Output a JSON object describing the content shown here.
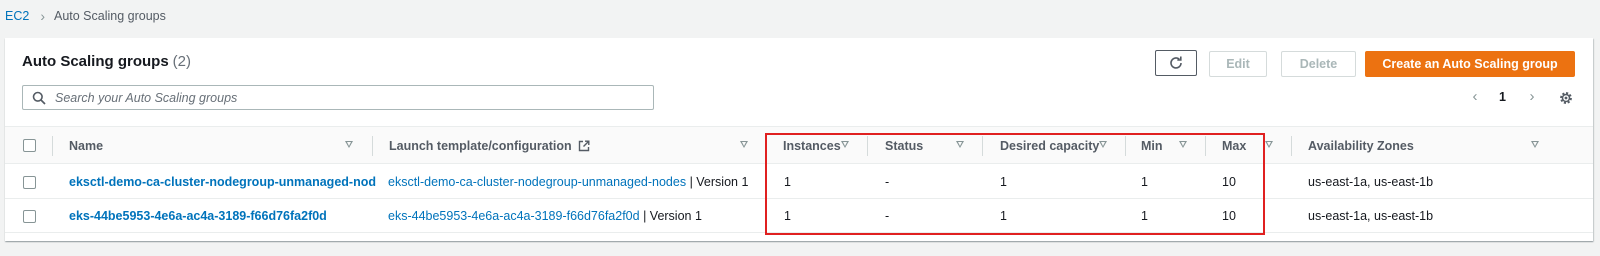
{
  "breadcrumb": {
    "root": "EC2",
    "current": "Auto Scaling groups"
  },
  "header": {
    "title": "Auto Scaling groups",
    "count": "(2)"
  },
  "toolbar": {
    "edit": "Edit",
    "delete": "Delete",
    "create": "Create an Auto Scaling group",
    "icons": {
      "refresh": "refresh-icon"
    }
  },
  "search": {
    "placeholder": "Search your Auto Scaling groups"
  },
  "pagination": {
    "current_page": "1"
  },
  "table": {
    "columns": [
      "Name",
      "Launch template/configuration",
      "Instances",
      "Status",
      "Desired capacity",
      "Min",
      "Max",
      "Availability Zones"
    ],
    "rows": [
      {
        "name": "eksctl-demo-ca-cluster-nodegroup-unmanaged-nod",
        "template": "eksctl-demo-ca-cluster-nodegroup-unmanaged-nodes",
        "version": "| Version 1",
        "instances": "1",
        "status": "-",
        "desired": "1",
        "min": "1",
        "max": "10",
        "zones": "us-east-1a, us-east-1b"
      },
      {
        "name": "eks-44be5953-4e6a-ac4a-3189-f66d76fa2f0d",
        "template": "eks-44be5953-4e6a-ac4a-3189-f66d76fa2f0d",
        "version": "| Version 1",
        "instances": "1",
        "status": "-",
        "desired": "1",
        "min": "1",
        "max": "10",
        "zones": "us-east-1a, us-east-1b"
      }
    ]
  },
  "colors": {
    "accent": "#ec7211",
    "link": "#0073bb",
    "highlight": "#e02020"
  }
}
